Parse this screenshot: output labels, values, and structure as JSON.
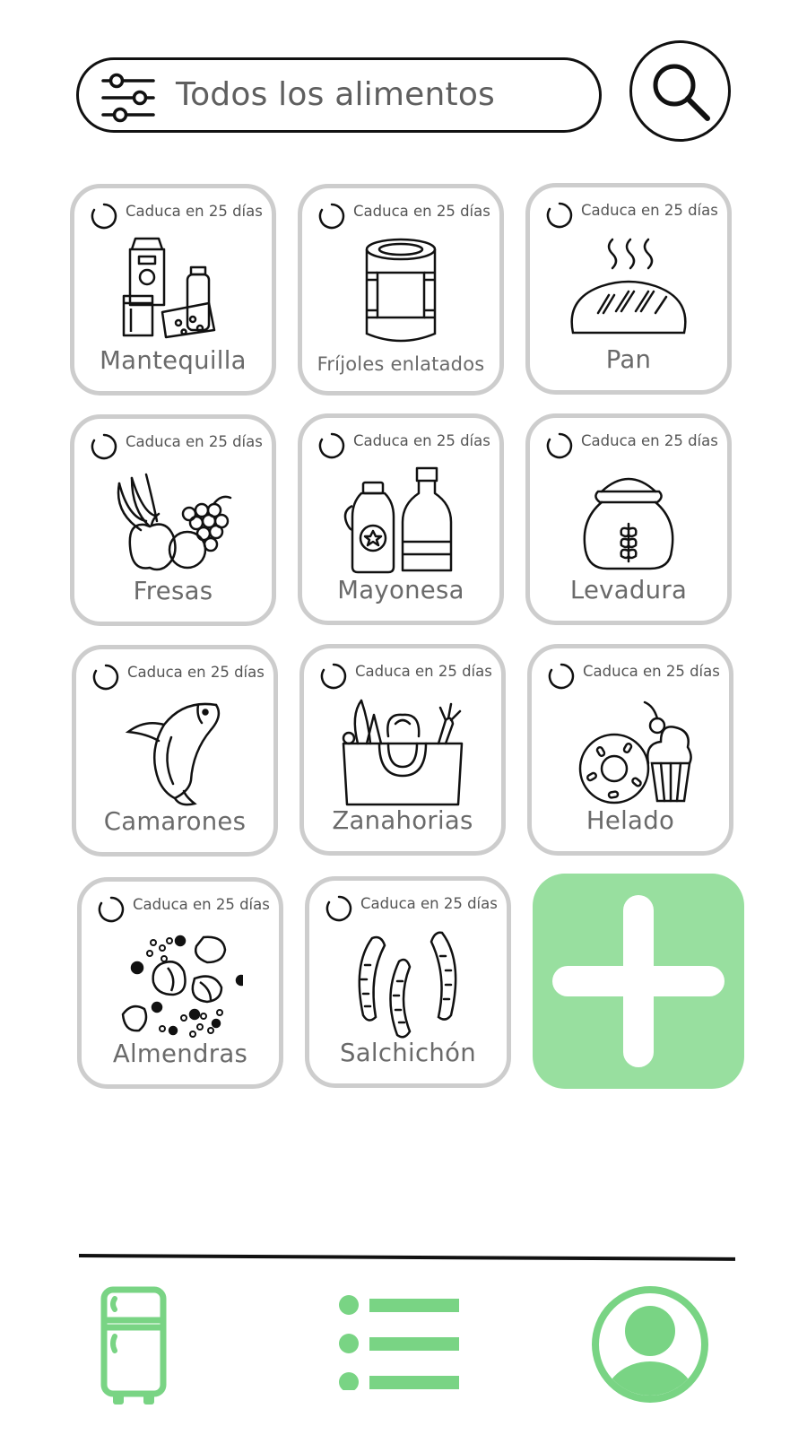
{
  "search": {
    "label": "Todos los alimentos"
  },
  "cards": [
    {
      "expiry": "Caduca en 25 días",
      "name": "Mantequilla",
      "icon": "dairy-icon"
    },
    {
      "expiry": "Caduca en 25 días",
      "name": "Fríjoles enlatados",
      "icon": "canned-food-icon"
    },
    {
      "expiry": "Caduca en 25 días",
      "name": "Pan",
      "icon": "bread-icon"
    },
    {
      "expiry": "Caduca en 25 días",
      "name": "Fresas",
      "icon": "fruits-icon"
    },
    {
      "expiry": "Caduca en 25 días",
      "name": "Mayonesa",
      "icon": "bottles-icon"
    },
    {
      "expiry": "Caduca en 25 días",
      "name": "Levadura",
      "icon": "flour-sack-icon"
    },
    {
      "expiry": "Caduca en 25 días",
      "name": "Camarones",
      "icon": "fish-icon"
    },
    {
      "expiry": "Caduca en 25 días",
      "name": "Zanahorias",
      "icon": "vegetables-bag-icon"
    },
    {
      "expiry": "Caduca en 25 días",
      "name": "Helado",
      "icon": "desserts-icon"
    },
    {
      "expiry": "Caduca en 25 días",
      "name": "Almendras",
      "icon": "nuts-seeds-icon"
    },
    {
      "expiry": "Caduca en 25 días",
      "name": "Salchichón",
      "icon": "sausages-icon"
    }
  ],
  "colors": {
    "accent": "#98df9f",
    "nav_icon": "#79d484",
    "card_border": "#cdcdcd",
    "text_muted": "#6a6a6a"
  },
  "nav": {
    "items": [
      "fridge-icon",
      "list-icon",
      "profile-icon"
    ]
  }
}
